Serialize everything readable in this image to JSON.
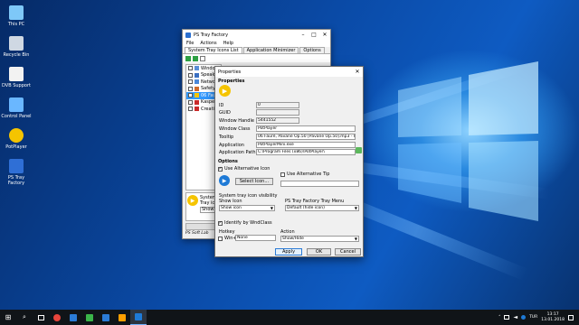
{
  "desktop": {
    "icons": [
      {
        "label": "This PC",
        "icon": "computer-icon"
      },
      {
        "label": "Recycle Bin",
        "icon": "recycle-bin-icon"
      },
      {
        "label": "DVB Support",
        "icon": "document-icon"
      },
      {
        "label": "Control Panel",
        "icon": "control-panel-icon"
      },
      {
        "label": "PotPlayer",
        "icon": "potplayer-icon"
      },
      {
        "label": "PS Tray Factory",
        "icon": "ps-tray-factory-icon"
      }
    ]
  },
  "main_window": {
    "title": "PS Tray Factory",
    "menu": [
      "File",
      "Actions",
      "Help"
    ],
    "tabs": [
      "System Tray Icons List",
      "Application Minimizer",
      "Options"
    ],
    "list_items": [
      {
        "label": "Windows",
        "checked": false
      },
      {
        "label": "Speaker",
        "checked": false
      },
      {
        "label": "Network",
        "checked": false
      },
      {
        "label": "Safety R",
        "checked": false
      },
      {
        "label": "06 Faure",
        "checked": true,
        "selected": true
      },
      {
        "label": "Kaspersk",
        "checked": false
      },
      {
        "label": "Creative",
        "checked": false
      }
    ],
    "bottom_panel": {
      "line1": "System",
      "line2": "Tray ic",
      "select_value": "Show"
    },
    "brand": "PS Soft Lab"
  },
  "dialog": {
    "title": "Properties",
    "properties_heading": "Properties",
    "fields": [
      {
        "label": "ID",
        "value": "0",
        "readonly": true
      },
      {
        "label": "GUID",
        "value": "",
        "readonly": true
      },
      {
        "label": "Window Handle",
        "value": "5441552",
        "readonly": true
      },
      {
        "label": "Window Class",
        "value": "PotPlayer",
        "readonly": false
      },
      {
        "label": "Tooltip",
        "value": "06 Fauré, Pavane Op.50 [Pavane Op.50].mp3 - PotPlay",
        "readonly": false
      },
      {
        "label": "Application",
        "value": "PotPlayerMini.exe",
        "readonly": false
      },
      {
        "label": "Application Path",
        "value": "C:\\Program Files (x86)\\PotPlayer\\",
        "readonly": false
      }
    ],
    "options_heading": "Options",
    "use_alt_icon": {
      "label": "Use Alternative Icon",
      "checked": true
    },
    "select_icon_button": "Select Icon...",
    "use_alt_tip": {
      "label": "Use Alternative Tip",
      "checked": false
    },
    "alt_tip_value": "",
    "visibility_group": "System tray icon visibility",
    "show_icon_label": "Show Icon",
    "show_icon_value": "Show icon",
    "menu_group": "PS Tray Factory Tray Menu",
    "menu_value": "Default (hide icon)",
    "identify_by_class": {
      "label": "Identify by WndClass",
      "checked": true
    },
    "hotkey_label": "Hotkey",
    "hotkey_win": {
      "label": "Win+",
      "checked": false
    },
    "hotkey_value": "None",
    "action_label": "Action",
    "action_value": "Show/Hide",
    "buttons": {
      "apply": "Apply",
      "ok": "OK",
      "cancel": "Cancel"
    }
  },
  "taskbar": {
    "items": [
      "start-icon",
      "search-icon",
      "task-view-icon",
      "chrome-icon",
      "store-icon",
      "camtasia-icon",
      "edge-icon",
      "media-icon",
      "ps-tray-factory-icon"
    ],
    "tray": {
      "language": "TUR",
      "time": "13:17",
      "date": "13.01.2018"
    }
  },
  "colors": {
    "accent": "#0078d7",
    "taskbar": "#101418",
    "selection": "#3399ff"
  }
}
